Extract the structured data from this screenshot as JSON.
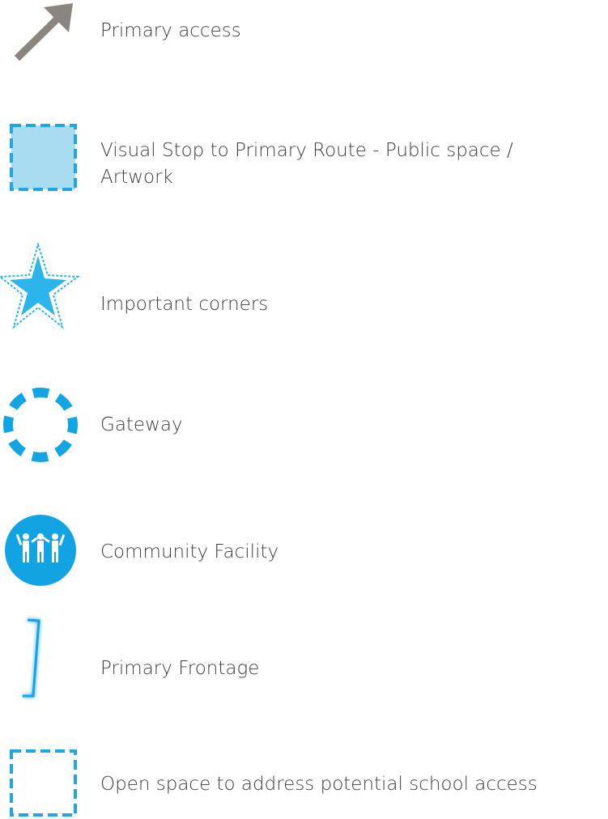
{
  "legend": {
    "items": [
      {
        "key": "primary_access",
        "label": "Primary access",
        "icon": "arrow-icon",
        "color": "#8a8580"
      },
      {
        "key": "visual_stop",
        "label": "Visual Stop to Primary Route - Public space / Artwork",
        "icon": "dashed-filled-square-icon",
        "color": "#1ea7e6",
        "fill": "#a9dcf0"
      },
      {
        "key": "important_corners",
        "label": "Important corners",
        "icon": "star-icon",
        "color": "#2bb5ea"
      },
      {
        "key": "gateway",
        "label": "Gateway",
        "icon": "dashed-circle-icon",
        "color": "#13a4e4"
      },
      {
        "key": "community_facility",
        "label": "Community Facility",
        "icon": "community-people-icon",
        "color": "#12a3e3"
      },
      {
        "key": "primary_frontage",
        "label": "Primary Frontage",
        "icon": "frontage-bracket-icon",
        "color": "#12a3e3"
      },
      {
        "key": "open_space",
        "label": "Open space to address potential school access",
        "icon": "dashed-square-icon",
        "color": "#1ea7e6"
      }
    ]
  }
}
